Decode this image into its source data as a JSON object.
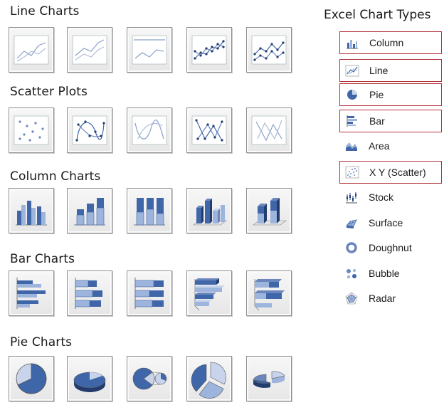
{
  "sections": {
    "line": "Line Charts",
    "scatter": "Scatter Plots",
    "column": "Column Charts",
    "bar": "Bar Charts",
    "pie": "Pie Charts"
  },
  "chart_types_panel": {
    "title": "Excel Chart Types",
    "items": [
      {
        "label": "Column",
        "icon": "column-chart-icon",
        "highlighted": true
      },
      {
        "label": "Line",
        "icon": "line-chart-icon",
        "highlighted": true
      },
      {
        "label": "Pie",
        "icon": "pie-chart-icon",
        "highlighted": true
      },
      {
        "label": "Bar",
        "icon": "bar-chart-icon",
        "highlighted": true
      },
      {
        "label": "Area",
        "icon": "area-chart-icon",
        "highlighted": false
      },
      {
        "label": "X Y (Scatter)",
        "icon": "scatter-chart-icon",
        "highlighted": true
      },
      {
        "label": "Stock",
        "icon": "stock-chart-icon",
        "highlighted": false
      },
      {
        "label": "Surface",
        "icon": "surface-chart-icon",
        "highlighted": false
      },
      {
        "label": "Doughnut",
        "icon": "doughnut-chart-icon",
        "highlighted": false
      },
      {
        "label": "Bubble",
        "icon": "bubble-chart-icon",
        "highlighted": false
      },
      {
        "label": "Radar",
        "icon": "radar-chart-icon",
        "highlighted": false
      }
    ]
  },
  "colors": {
    "highlight_border": "#b3333b",
    "icon_blue": "#3f66a8",
    "icon_light_blue": "#9db4dc"
  }
}
